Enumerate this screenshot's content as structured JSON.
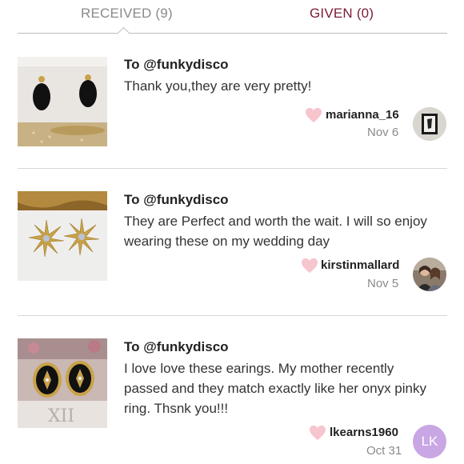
{
  "tabs": {
    "received": "RECEIVED (9)",
    "given": "GIVEN (0)"
  },
  "colors": {
    "given_accent": "#7b1b34",
    "heart": "#f7c5cd",
    "avatar_lk": "#c9a6e4"
  },
  "reviews": [
    {
      "to": "To @funkydisco",
      "message": "Thank you,they are very pretty!",
      "user": "marianna_16",
      "date": "Nov 6",
      "heart_icon": "heart-icon"
    },
    {
      "to": "To @funkydisco",
      "message": "They are Perfect and worth the wait. I will so enjoy wearing these on my wedding day",
      "user": "kirstinmallard",
      "date": "Nov 5",
      "heart_icon": "heart-icon"
    },
    {
      "to": "To @funkydisco",
      "message": "I love love these earings. My mother recently passed and they match exactly like her onyx pinky ring. Thsnk you!!!",
      "user": "lkearns1960",
      "date": "Oct 31",
      "avatar_initials": "LK",
      "heart_icon": "heart-icon"
    }
  ]
}
